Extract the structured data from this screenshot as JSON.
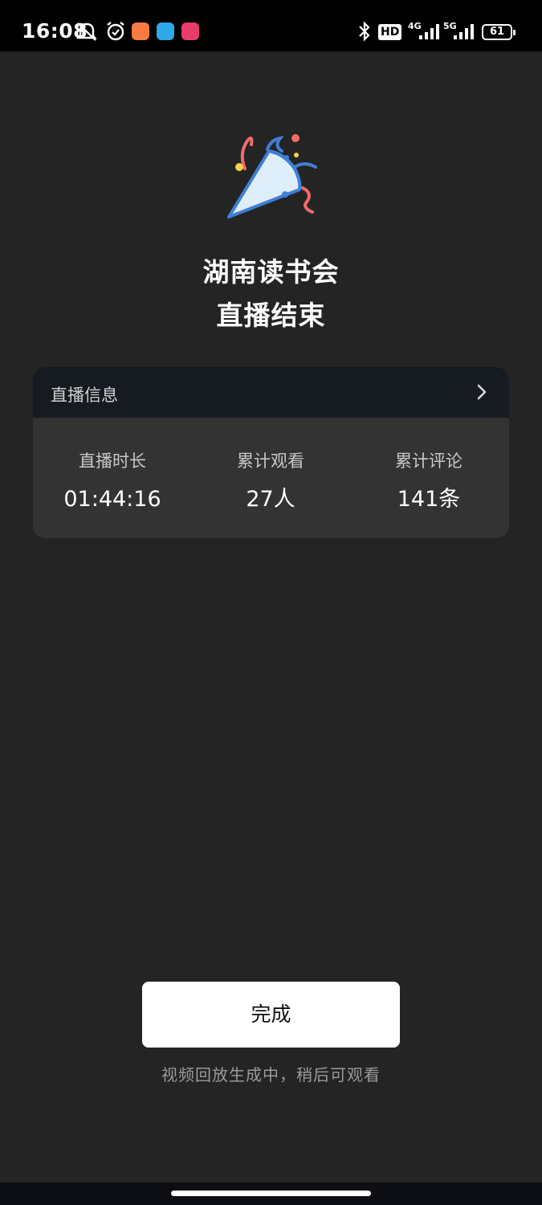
{
  "status_bar": {
    "time": "16:08",
    "hd_label": "HD",
    "net_4g": "4G",
    "net_5g": "5G",
    "battery": "61",
    "icons": [
      "mute-bell-icon",
      "alarm-icon",
      "app-icon-orange",
      "app-icon-map",
      "app-icon-pink",
      "bluetooth-icon",
      "signal-icon"
    ]
  },
  "header": {
    "icon": "party-popper-icon",
    "title_line1": "湖南读书会",
    "title_line2": "直播结束"
  },
  "info_card": {
    "header_label": "直播信息",
    "stats": [
      {
        "label": "直播时长",
        "value": "01:44:16"
      },
      {
        "label": "累计观看",
        "value": "27人"
      },
      {
        "label": "累计评论",
        "value": "141条"
      }
    ]
  },
  "actions": {
    "done_label": "完成",
    "footnote": "视频回放生成中，稍后可观看"
  },
  "colors": {
    "background": "#242424",
    "card": "#333333",
    "card_header": "#161a21",
    "button": "#ffffff"
  }
}
